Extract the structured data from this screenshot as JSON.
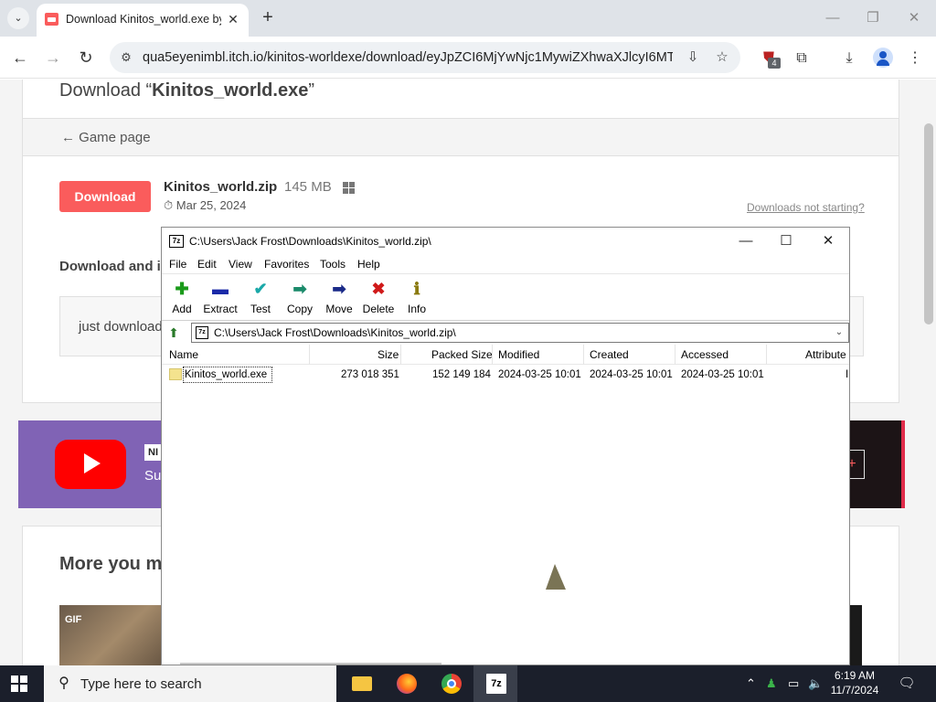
{
  "browser": {
    "tab_title": "Download Kinitos_world.exe by",
    "url": "qua5eyenimbl.itch.io/kinitos-worldexe/download/eyJpZCI6MjYwNjc1MywiZXhwaXJlcyI6MTc...",
    "extension_badge": "4",
    "colors": {
      "tabbar": "#dfe3e8",
      "omnibox": "#eef1f4"
    }
  },
  "page": {
    "download_prefix": "Download “",
    "download_name": "Kinitos_world.exe",
    "download_suffix": "”",
    "game_page": "← Game page",
    "download_button": "Download",
    "file_name": "Kinitos_world.zip",
    "file_size": "145 MB",
    "file_date": "Mar 25, 2024",
    "downloads_not_starting": "Downloads not starting?",
    "download_and_heading": "Download and i",
    "just_download": "just download",
    "banner_badge": "NI",
    "banner_sub": "Su",
    "banner_btn": "+",
    "more_title": "More you mi",
    "gif_badge": "GIF",
    "accent_color": "#fa5c5c"
  },
  "sevenzip": {
    "title": "C:\\Users\\Jack Frost\\Downloads\\Kinitos_world.zip\\",
    "app_icon": "7z",
    "menu": [
      "File",
      "Edit",
      "View",
      "Favorites",
      "Tools",
      "Help"
    ],
    "toolbar": [
      {
        "label": "Add",
        "icon": "plus-icon",
        "glyph": "✚",
        "color": "#1a9a1a"
      },
      {
        "label": "Extract",
        "icon": "minus-icon",
        "glyph": "▬",
        "color": "#1a2aa8"
      },
      {
        "label": "Test",
        "icon": "check-icon",
        "glyph": "✔",
        "color": "#1aa8a8"
      },
      {
        "label": "Copy",
        "icon": "arrow-right-double-icon",
        "glyph": "➡",
        "color": "#1a8a6a"
      },
      {
        "label": "Move",
        "icon": "arrow-right-icon",
        "glyph": "➡",
        "color": "#1a2a88"
      },
      {
        "label": "Delete",
        "icon": "x-icon",
        "glyph": "✖",
        "color": "#d01a1a"
      },
      {
        "label": "Info",
        "icon": "info-icon",
        "glyph": "ℹ",
        "color": "#8a7a10"
      }
    ],
    "path": "C:\\Users\\Jack Frost\\Downloads\\Kinitos_world.zip\\",
    "columns": [
      "Name",
      "Size",
      "Packed Size",
      "Modified",
      "Created",
      "Accessed",
      "Attribute"
    ],
    "rows": [
      {
        "name": "Kinitos_world.exe",
        "size": "273 018 351",
        "packed": "152 149 184",
        "modified": "2024-03-25 10:01",
        "created": "2024-03-25 10:01",
        "accessed": "2024-03-25 10:01",
        "attr": "I"
      }
    ]
  },
  "taskbar": {
    "search_placeholder": "Type here to search",
    "time": "6:19 AM",
    "date": "11/7/2024",
    "apps": [
      "file-explorer",
      "firefox",
      "chrome",
      "7zip"
    ],
    "app_7z": "7z"
  }
}
